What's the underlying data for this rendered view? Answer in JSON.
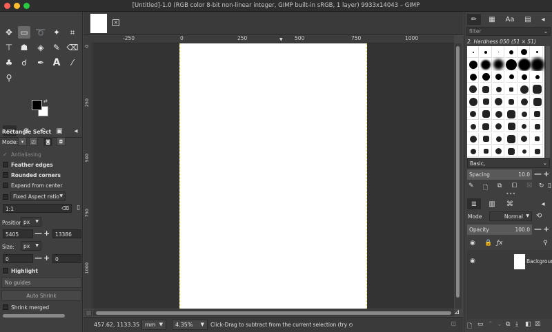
{
  "window": {
    "title": "[Untitled]-1.0 (RGB color 8-bit non-linear integer, GIMP built-in sRGB, 1 layer) 9933x14043 – GIMP"
  },
  "tool_options": {
    "tool_name": "Rectangle Select",
    "mode_label": "Mode:",
    "antialiasing": "Antialiasing",
    "feather_edges": "Feather edges",
    "rounded_corners": "Rounded corners",
    "expand_from_center": "Expand from center",
    "fixed": "Fixed",
    "fixed_value": "Aspect ratio",
    "ratio_value": "1:1",
    "position_label": "Position:",
    "position_unit": "px",
    "position_x": "5405",
    "position_y": "13386",
    "size_label": "Size:",
    "size_unit": "px",
    "size_w": "0",
    "size_h": "0",
    "highlight": "Highlight",
    "guides": "No guides",
    "auto_shrink": "Auto Shrink",
    "shrink_merged": "Shrink merged"
  },
  "rulers": {
    "h_labels": [
      "-250",
      "0",
      "250",
      "500",
      "750",
      "1000"
    ],
    "v_labels": [
      "0",
      "250",
      "500",
      "750",
      "1000"
    ]
  },
  "statusbar": {
    "coords": "457.62, 1133.35",
    "unit": "mm",
    "zoom": "4.35%",
    "message": "Click-Drag to subtract from the current selection (try ⊙"
  },
  "brushes": {
    "filter_placeholder": "filter",
    "selected_brush": "2. Hardness 050 (51 × 51)",
    "tag": "Basic,",
    "spacing_label": "Spacing",
    "spacing_value": "10.0"
  },
  "layers": {
    "mode_label": "Mode",
    "mode_value": "Normal",
    "opacity_label": "Opacity",
    "opacity_value": "100.0",
    "layer_name": "Background"
  },
  "colors": {
    "foreground": "#000000",
    "background": "#ffffff"
  }
}
